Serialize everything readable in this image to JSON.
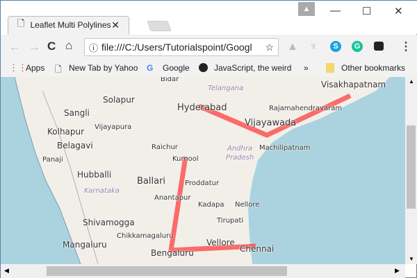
{
  "browser": {
    "tab_title": "Leaflet Multi Polylines",
    "url": "file:///C:/Users/Tutorialspoint/Googl",
    "bookmarks": [
      "Apps",
      "New Tab by Yahoo",
      "Google",
      "JavaScript, the weird"
    ],
    "overflow": "»",
    "other_bookmarks": "Other bookmarks"
  },
  "map": {
    "labels": [
      {
        "t": "Bidar",
        "s": 10
      },
      {
        "t": "Telangana",
        "s": 10,
        "i": true
      },
      {
        "t": "Visakhapatnam",
        "s": 12
      },
      {
        "t": "Solapur",
        "s": 12
      },
      {
        "t": "Hyderabad",
        "s": 13
      },
      {
        "t": "Rajamahendravaram",
        "s": 10
      },
      {
        "t": "Sangli",
        "s": 12
      },
      {
        "t": "Vijayawada",
        "s": 13
      },
      {
        "t": "Vijayapura",
        "s": 10
      },
      {
        "t": "Kolhapur",
        "s": 12
      },
      {
        "t": "Belagavi",
        "s": 12
      },
      {
        "t": "Raichur",
        "s": 10
      },
      {
        "t": "Andhra",
        "s": 10,
        "i": true
      },
      {
        "t": "Machilipatnam",
        "s": 10
      },
      {
        "t": "Panaji",
        "s": 10
      },
      {
        "t": "Kurnool",
        "s": 10
      },
      {
        "t": "Pradesh",
        "s": 10,
        "i": true
      },
      {
        "t": "Hubballi",
        "s": 12
      },
      {
        "t": "Ballari",
        "s": 13
      },
      {
        "t": "Proddatur",
        "s": 10
      },
      {
        "t": "Karnataka",
        "s": 10,
        "i": true
      },
      {
        "t": "Anantapur",
        "s": 10
      },
      {
        "t": "Kadapa",
        "s": 10
      },
      {
        "t": "Nellore",
        "s": 10
      },
      {
        "t": "Tirupati",
        "s": 10
      },
      {
        "t": "Shivamogga",
        "s": 12
      },
      {
        "t": "Chikkamagaluru",
        "s": 10
      },
      {
        "t": "Mangaluru",
        "s": 12
      },
      {
        "t": "Vellore",
        "s": 12
      },
      {
        "t": "Chennai",
        "s": 12
      },
      {
        "t": "Bengaluru",
        "s": 12
      }
    ],
    "line_color": "#ff3333",
    "polylines": [
      [
        "Hyderabad",
        "Vijayawada",
        "Visakhapatnam"
      ],
      [
        "Kurnool",
        "Bengaluru",
        "Chennai"
      ]
    ]
  }
}
